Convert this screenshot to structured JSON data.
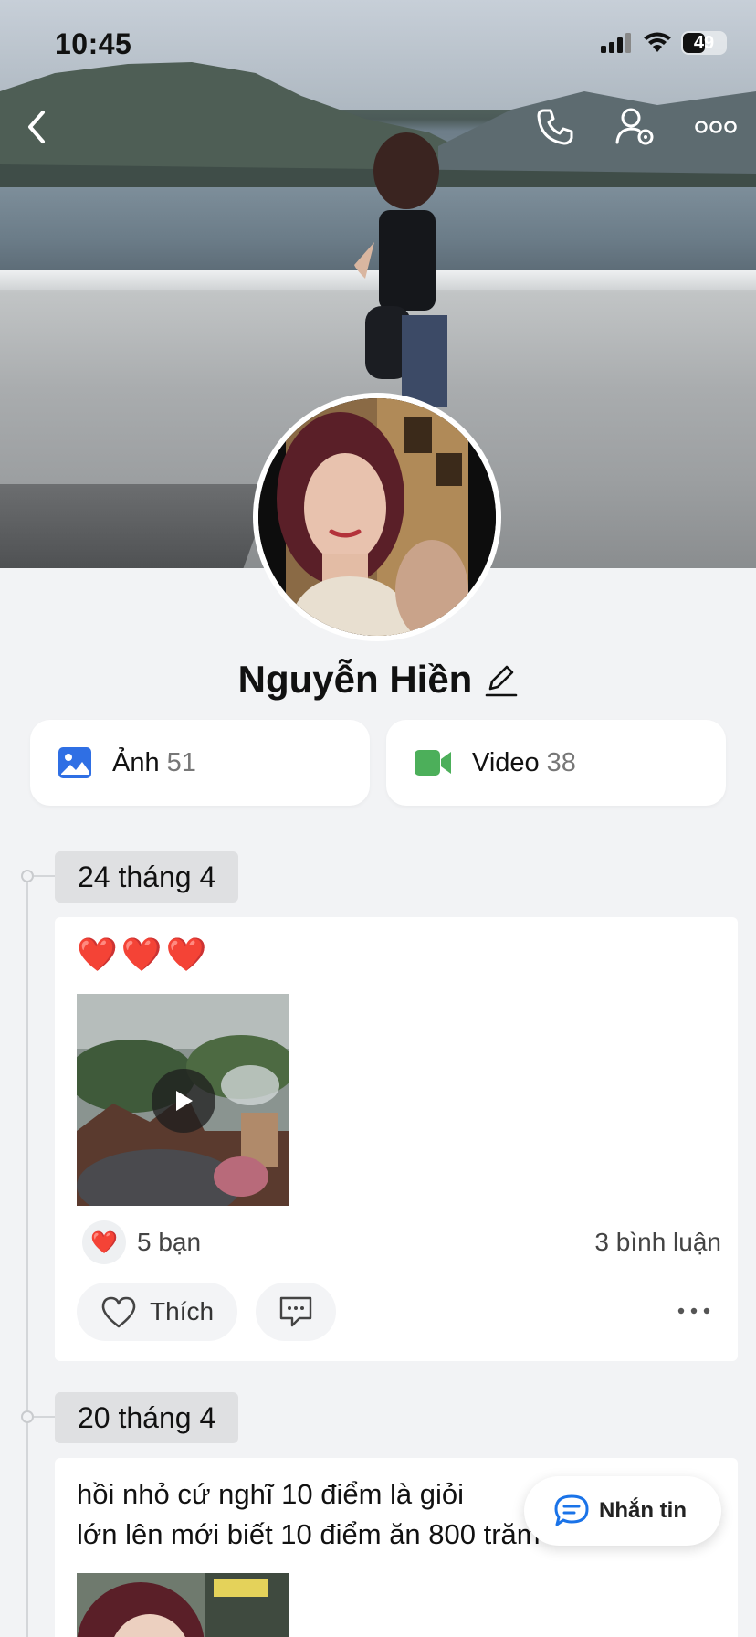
{
  "status_bar": {
    "time": "10:45",
    "battery": "49"
  },
  "profile": {
    "name": "Nguyễn Hiền"
  },
  "media": {
    "photos": {
      "label": "Ảnh",
      "count": "51"
    },
    "videos": {
      "label": "Video",
      "count": "38"
    }
  },
  "posts": [
    {
      "date": "24 tháng 4",
      "content": "❤️❤️❤️",
      "reactions": "5 bạn",
      "comments": "3 bình luận",
      "like_label": "Thích"
    },
    {
      "date": "20 tháng 4",
      "text_line1": "hồi nhỏ cứ nghĩ 10 điểm là giỏi",
      "text_line2": "lớn lên mới biết 10 điểm ăn 800 trăm"
    }
  ],
  "message_button": {
    "label": "Nhắn tin"
  },
  "colors": {
    "photo_icon": "#2f6fe4",
    "video_icon": "#4caf5a",
    "accent": "#1a73e8"
  }
}
